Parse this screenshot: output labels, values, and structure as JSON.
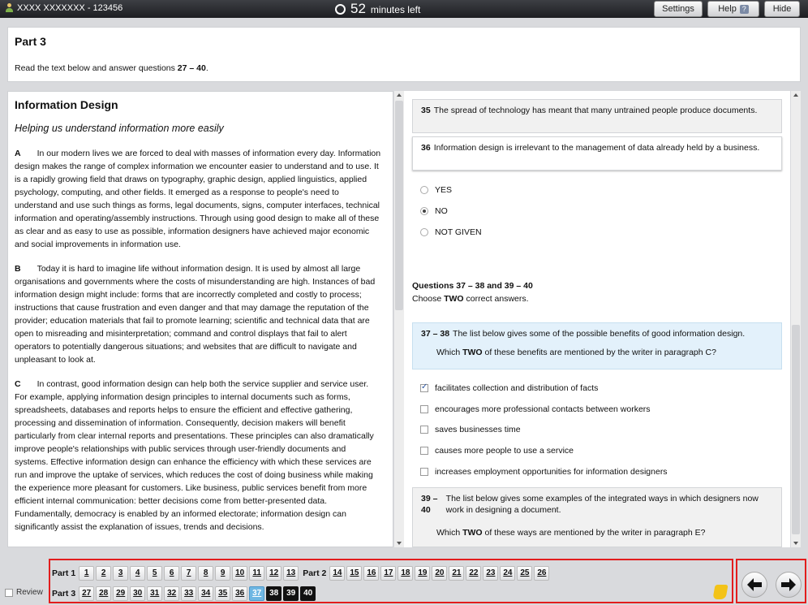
{
  "topbar": {
    "candidate": "XXXX XXXXXXX - 123456",
    "timer_value": "52",
    "timer_label": "minutes left",
    "settings_label": "Settings",
    "help_label": "Help",
    "help_badge": "?",
    "hide_label": "Hide"
  },
  "part": {
    "title": "Part 3",
    "instruction_pre": "Read the text below and answer questions ",
    "instruction_range": "27 – 40",
    "instruction_post": "."
  },
  "reading": {
    "title": "Information Design",
    "subtitle": "Helping us understand information more easily",
    "paragraphs": [
      {
        "label": "A",
        "text": "In our modern lives we are forced to deal with masses of information every day. Information design makes the range of complex information we encounter easier to understand and to use. It is a rapidly growing field that draws on typography, graphic design, applied linguistics, applied psychology, computing, and other fields. It emerged as a response to people's need to understand and use such things as forms, legal documents, signs, computer interfaces, technical information and operating/assembly instructions. Through using good design to make all of these as clear and as easy to use as possible, information designers have achieved major economic and social improvements in information use."
      },
      {
        "label": "B",
        "text": "Today it is hard to imagine life without information design. It is used by almost all large organisations and governments where the costs of misunderstanding are high. Instances of bad information design might include: forms that are incorrectly completed and costly to process; instructions that cause frustration and even danger and that may damage the reputation of the provider; education materials that fail to promote learning; scientific and technical data that are open to misreading and misinterpretation; command and control displays that fail to alert operators to potentially dangerous situations; and websites that are difficult to navigate and unpleasant to look at."
      },
      {
        "label": "C",
        "text": "In contrast, good information design can help both the service supplier and service user. For example, applying information design principles to internal documents such as forms, spreadsheets, databases and reports helps to ensure the efficient and effective gathering, processing and dissemination of information. Consequently, decision makers will benefit particularly from clear internal reports and presentations. These principles can also dramatically improve people's relationships with public services through user-friendly documents and systems. Effective information design can enhance the efficiency with which these services are run and improve the uptake of services, which reduces the cost of doing business while making the experience more pleasant for customers. Like business, public services benefit from more efficient internal communication: better decisions come from better-presented data. Fundamentally, democracy is enabled by an informed electorate; information design can significantly assist the explanation of issues, trends and decisions."
      }
    ]
  },
  "questions": {
    "q35_num": "35",
    "q35_text": "The spread of technology has meant that many untrained people produce documents.",
    "q36_num": "36",
    "q36_text": "Information design is irrelevant to the management of data already held by a business.",
    "ynng": [
      "YES",
      "NO",
      "NOT GIVEN"
    ],
    "ynng_selected": "NO",
    "group_title": "Questions 37 – 38 and 39 – 40",
    "group_instr_pre": "Choose ",
    "group_instr_bold": "TWO",
    "group_instr_post": " correct answers.",
    "q3738_num": "37 – 38",
    "q3738_text": "The list below gives some of the possible benefits of good information design.",
    "q3738_sub_pre": "Which ",
    "q3738_sub_bold": "TWO",
    "q3738_sub_post": " of these benefits are mentioned by the writer in paragraph C?",
    "q3738_options": [
      "facilitates collection and distribution of facts",
      "encourages more professional contacts between workers",
      "saves businesses time",
      "causes more people to use a service",
      "increases employment opportunities for information designers"
    ],
    "q3738_checked": [
      "facilitates collection and distribution of facts"
    ],
    "q3940_num": "39 – 40",
    "q3940_text": "The list below gives some examples of the integrated ways in which designers now work in designing a document.",
    "q3940_sub_pre": "Which ",
    "q3940_sub_bold": "TWO",
    "q3940_sub_post": " of these ways are mentioned by the writer in paragraph E?"
  },
  "nav": {
    "review_label": "Review",
    "part1_label": "Part 1",
    "part1_qs": [
      "1",
      "2",
      "3",
      "4",
      "5",
      "6",
      "7",
      "8",
      "9",
      "10",
      "11",
      "12",
      "13"
    ],
    "part2_label": "Part 2",
    "part2_qs": [
      "14",
      "15",
      "16",
      "17",
      "18",
      "19",
      "20",
      "21",
      "22",
      "23",
      "24",
      "25",
      "26"
    ],
    "part3_label": "Part 3",
    "part3_qs": [
      "27",
      "28",
      "29",
      "30",
      "31",
      "32",
      "33",
      "34",
      "35",
      "36",
      "37",
      "38",
      "39",
      "40"
    ],
    "current": "37",
    "answered": [
      "38",
      "39",
      "40"
    ]
  },
  "colors": {
    "highlight_blue": "#e3f1fb",
    "current_blue": "#6fb7e3",
    "frame_red": "#e21d1d"
  }
}
